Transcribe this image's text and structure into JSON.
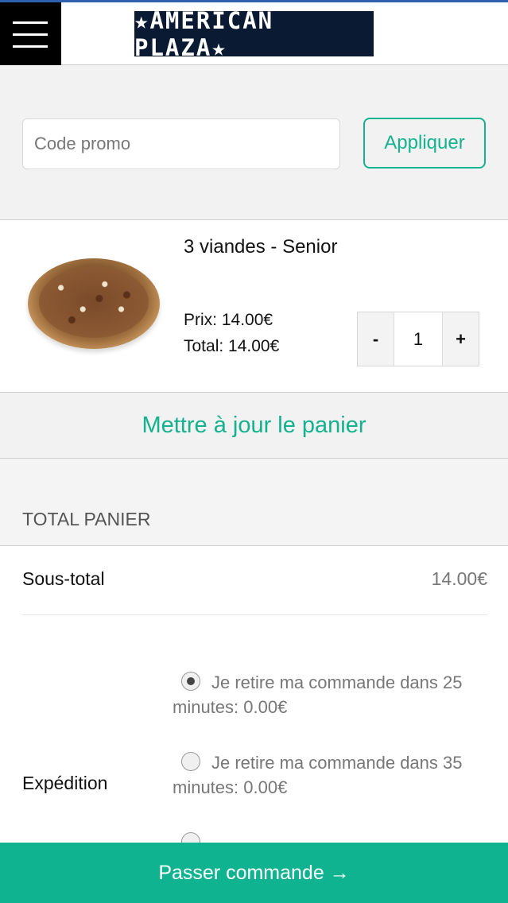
{
  "header": {
    "logo_text": "★AMERICAN PLAZA★"
  },
  "promo": {
    "placeholder": "Code promo",
    "apply_label": "Appliquer"
  },
  "cart_item": {
    "name": "3 viandes - Senior",
    "price": "Prix: 14.00€",
    "total": "Total: 14.00€",
    "qty_minus": "-",
    "qty_value": "1",
    "qty_plus": "+"
  },
  "update_label": "Mettre à jour le panier",
  "totals": {
    "title": "TOTAL PANIER",
    "subtotal_label": "Sous-total",
    "subtotal_value": "14.00€",
    "shipping_label": "Expédition",
    "options": [
      {
        "text": "Je retire ma commande dans 25 minutes: 0.00€",
        "checked": true
      },
      {
        "text": "Je retire ma commande dans 35 minutes: 0.00€",
        "checked": false
      }
    ]
  },
  "checkout_label": "Passer commande →",
  "colors": {
    "accent": "#14b28e",
    "footer": "#10b38f",
    "logo_bg": "#0b1a33"
  }
}
